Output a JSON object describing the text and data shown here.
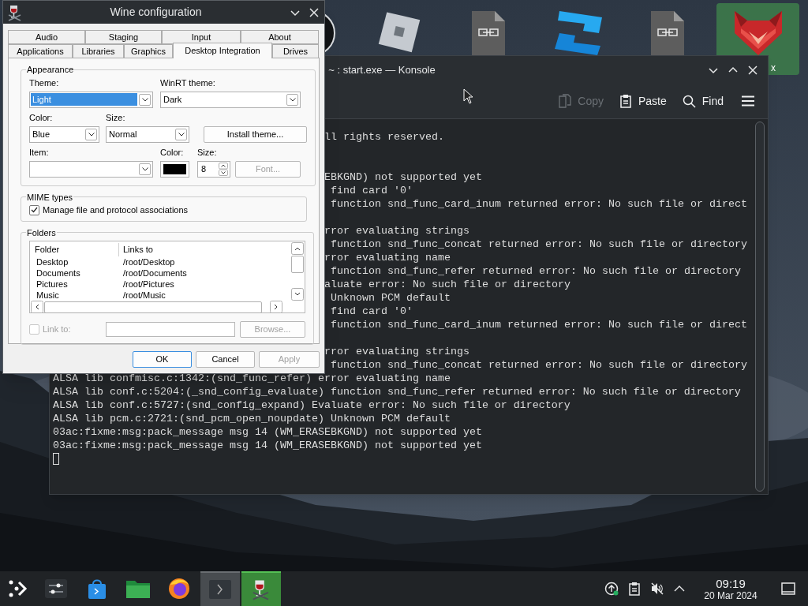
{
  "desktop": {
    "icons": [
      {
        "kind": "disc",
        "selected": false
      },
      {
        "kind": "tilted_square",
        "selected": false
      },
      {
        "kind": "file",
        "selected": false
      },
      {
        "kind": "blue_shape",
        "selected": false
      },
      {
        "kind": "file",
        "selected": false
      },
      {
        "kind": "fox",
        "selected": true,
        "label": "x"
      }
    ]
  },
  "wine_window": {
    "title": "Wine configuration",
    "tabs_row_1": [
      {
        "label": "Audio",
        "selected": false
      },
      {
        "label": "Staging",
        "selected": false
      },
      {
        "label": "Input",
        "selected": false
      },
      {
        "label": "About",
        "selected": false
      }
    ],
    "tabs_row_2": [
      {
        "label": "Applications",
        "selected": false
      },
      {
        "label": "Libraries",
        "selected": false
      },
      {
        "label": "Graphics",
        "selected": false
      },
      {
        "label": "Desktop Integration",
        "selected": true
      },
      {
        "label": "Drives",
        "selected": false
      }
    ],
    "appearance": {
      "title": "Appearance",
      "theme": {
        "label": "Theme:",
        "value": "Light",
        "focused": true
      },
      "winrt_theme": {
        "label": "WinRT theme:",
        "value": "Dark",
        "focused": false
      },
      "color": {
        "label": "Color:",
        "value": "Blue"
      },
      "size": {
        "label": "Size:",
        "value": "Normal"
      },
      "install_button": "Install theme...",
      "item": {
        "label": "Item:"
      },
      "item_color": {
        "label": "Color:",
        "color": "#000000"
      },
      "item_size": {
        "label": "Size:",
        "value": "8"
      },
      "font_button": {
        "label": "Font...",
        "disabled": true
      }
    },
    "mime_types": {
      "title": "MIME types",
      "checkbox": {
        "label": "Manage file and protocol associations",
        "checked": true,
        "disabled": false
      }
    },
    "folders": {
      "title": "Folders",
      "columns": [
        "Folder",
        "Links to"
      ],
      "rows": [
        {
          "folder": "Desktop",
          "links_to": "/root/Desktop"
        },
        {
          "folder": "Documents",
          "links_to": "/root/Documents"
        },
        {
          "folder": "Pictures",
          "links_to": "/root/Pictures"
        },
        {
          "folder": "Music",
          "links_to": "/root/Music"
        }
      ],
      "link_checkbox": {
        "label": "Link to:",
        "checked": false,
        "disabled": true
      },
      "browse_button": {
        "label": "Browse...",
        "disabled": true
      }
    },
    "buttons": [
      {
        "label": "OK",
        "default": true,
        "disabled": false
      },
      {
        "label": "Cancel",
        "default": false,
        "disabled": false
      },
      {
        "label": "Apply",
        "default": false,
        "disabled": true
      }
    ]
  },
  "konsole": {
    "title": "~ : start.exe — Konsole",
    "toolbar": [
      {
        "kind": "copy",
        "label": "Copy",
        "disabled": true
      },
      {
        "kind": "paste",
        "label": "Paste",
        "disabled": false
      },
      {
        "kind": "find",
        "label": "Find",
        "disabled": false
      },
      {
        "kind": "menu",
        "disabled": false
      }
    ],
    "lines": [
      {
        "kind": "partial",
        "text": "ll rights reserved."
      },
      {
        "kind": "blank"
      },
      {
        "kind": "blank"
      },
      {
        "kind": "partial",
        "text": "EBKGND) not supported yet"
      },
      {
        "kind": "partial",
        "text": " find card '0'"
      },
      {
        "kind": "partial",
        "text": " function snd_func_card_inum returned error: No such file or direct"
      },
      {
        "kind": "blank"
      },
      {
        "kind": "partial",
        "text": "rror evaluating strings"
      },
      {
        "kind": "partial",
        "text": " function snd_func_concat returned error: No such file or directory"
      },
      {
        "kind": "partial",
        "text": "rror evaluating name"
      },
      {
        "kind": "partial",
        "text": " function snd_func_refer returned error: No such file or directory"
      },
      {
        "kind": "partial",
        "text": "aluate error: No such file or directory"
      },
      {
        "kind": "partial",
        "text": " Unknown PCM default"
      },
      {
        "kind": "partial",
        "text": " find card '0'"
      },
      {
        "kind": "partial",
        "text": " function snd_func_card_inum returned error: No such file or direct"
      },
      {
        "kind": "blank"
      },
      {
        "kind": "partial",
        "text": "rror evaluating strings"
      },
      {
        "kind": "partial",
        "text": " function snd_func_concat returned error: No such file or directory"
      },
      {
        "kind": "text",
        "text": "ALSA lib confmisc.c:1342:(snd_func_refer) error evaluating name"
      },
      {
        "kind": "text",
        "text": "ALSA lib conf.c:5204:(_snd_config_evaluate) function snd_func_refer returned error: No such file or directory"
      },
      {
        "kind": "text",
        "text": "ALSA lib conf.c:5727:(snd_config_expand) Evaluate error: No such file or directory"
      },
      {
        "kind": "text",
        "text": "ALSA lib pcm.c:2721:(snd_pcm_open_noupdate) Unknown PCM default"
      },
      {
        "kind": "text",
        "text": "03ac:fixme:msg:pack_message msg 14 (WM_ERASEBKGND) not supported yet"
      },
      {
        "kind": "text",
        "text": "03ac:fixme:msg:pack_message msg 14 (WM_ERASEBKGND) not supported yet"
      },
      {
        "kind": "cursor"
      }
    ]
  },
  "taskbar": {
    "apps": [
      {
        "kind": "launcher",
        "open": false,
        "selected": false
      },
      {
        "kind": "settings",
        "open": false,
        "selected": false
      },
      {
        "kind": "store",
        "open": false,
        "selected": false
      },
      {
        "kind": "folder",
        "open": false,
        "selected": false
      },
      {
        "kind": "browser",
        "open": false,
        "selected": false
      },
      {
        "kind": "terminal",
        "open": true,
        "selected": false
      },
      {
        "kind": "wine",
        "open": true,
        "selected": true
      }
    ],
    "tray": [
      {
        "kind": "update"
      },
      {
        "kind": "clipboard"
      },
      {
        "kind": "muted"
      },
      {
        "kind": "expand"
      }
    ],
    "clock": {
      "time": "09:19",
      "date": "20 Mar 2024"
    }
  }
}
